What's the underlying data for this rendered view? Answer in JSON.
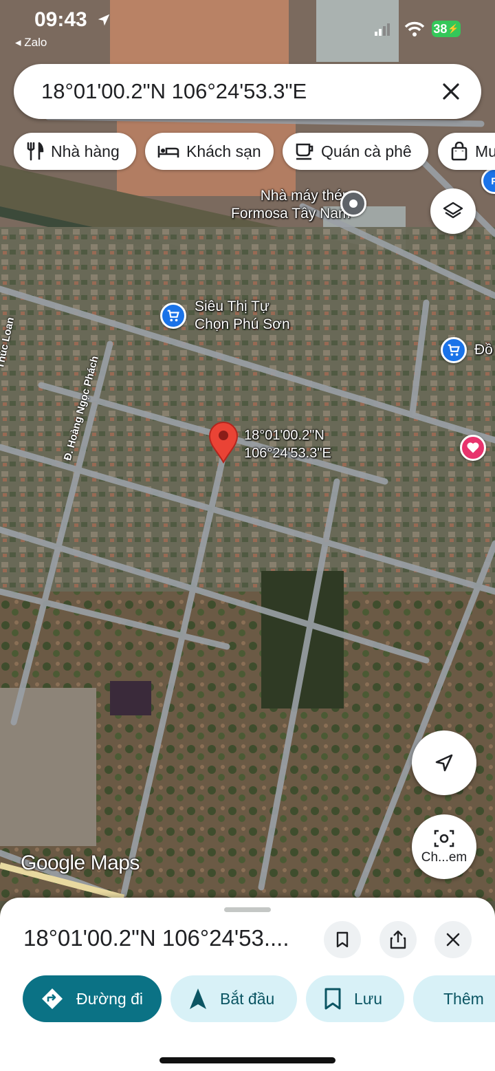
{
  "status_bar": {
    "time": "09:43",
    "back_app": "◂ Zalo",
    "battery": "38"
  },
  "search": {
    "query": "18°01'00.2\"N 106°24'53.3\"E"
  },
  "chips": [
    {
      "label": "Nhà hàng",
      "icon": "fork-knife-icon"
    },
    {
      "label": "Khách sạn",
      "icon": "bed-icon"
    },
    {
      "label": "Quán cà phê",
      "icon": "coffee-icon"
    },
    {
      "label": "Mu",
      "icon": "shopping-bag-icon"
    }
  ],
  "map": {
    "places": {
      "factory": "Nhà máy thép\nFormosa Tây Nam",
      "supermarket": "Siêu Thị Tự\nChọn Phú Sơn",
      "edge_poi": "Đồ",
      "edge_poi_top": "P"
    },
    "roads": {
      "left": "Thúc Loan",
      "middle": "Đ. Hoàng Ngọc Phách"
    },
    "pin_label": "18°01'00.2\"N\n106°24'53.3\"E",
    "attribution": "Google Maps",
    "colors": {
      "pin": "#ea4335",
      "shopping": "#1a73e8",
      "saved": "#e8336d"
    }
  },
  "fabs": {
    "camera_label": "Ch...em"
  },
  "sheet": {
    "title": "18°01'00.2\"N 106°24'53....",
    "actions": [
      {
        "label": "Đường đi",
        "icon": "directions-icon"
      },
      {
        "label": "Bắt đầu",
        "icon": "navigation-arrow-icon"
      },
      {
        "label": "Lưu",
        "icon": "bookmark-icon"
      },
      {
        "label": "Thêm",
        "icon": "flag-icon"
      }
    ],
    "accent": "#0b7285"
  }
}
